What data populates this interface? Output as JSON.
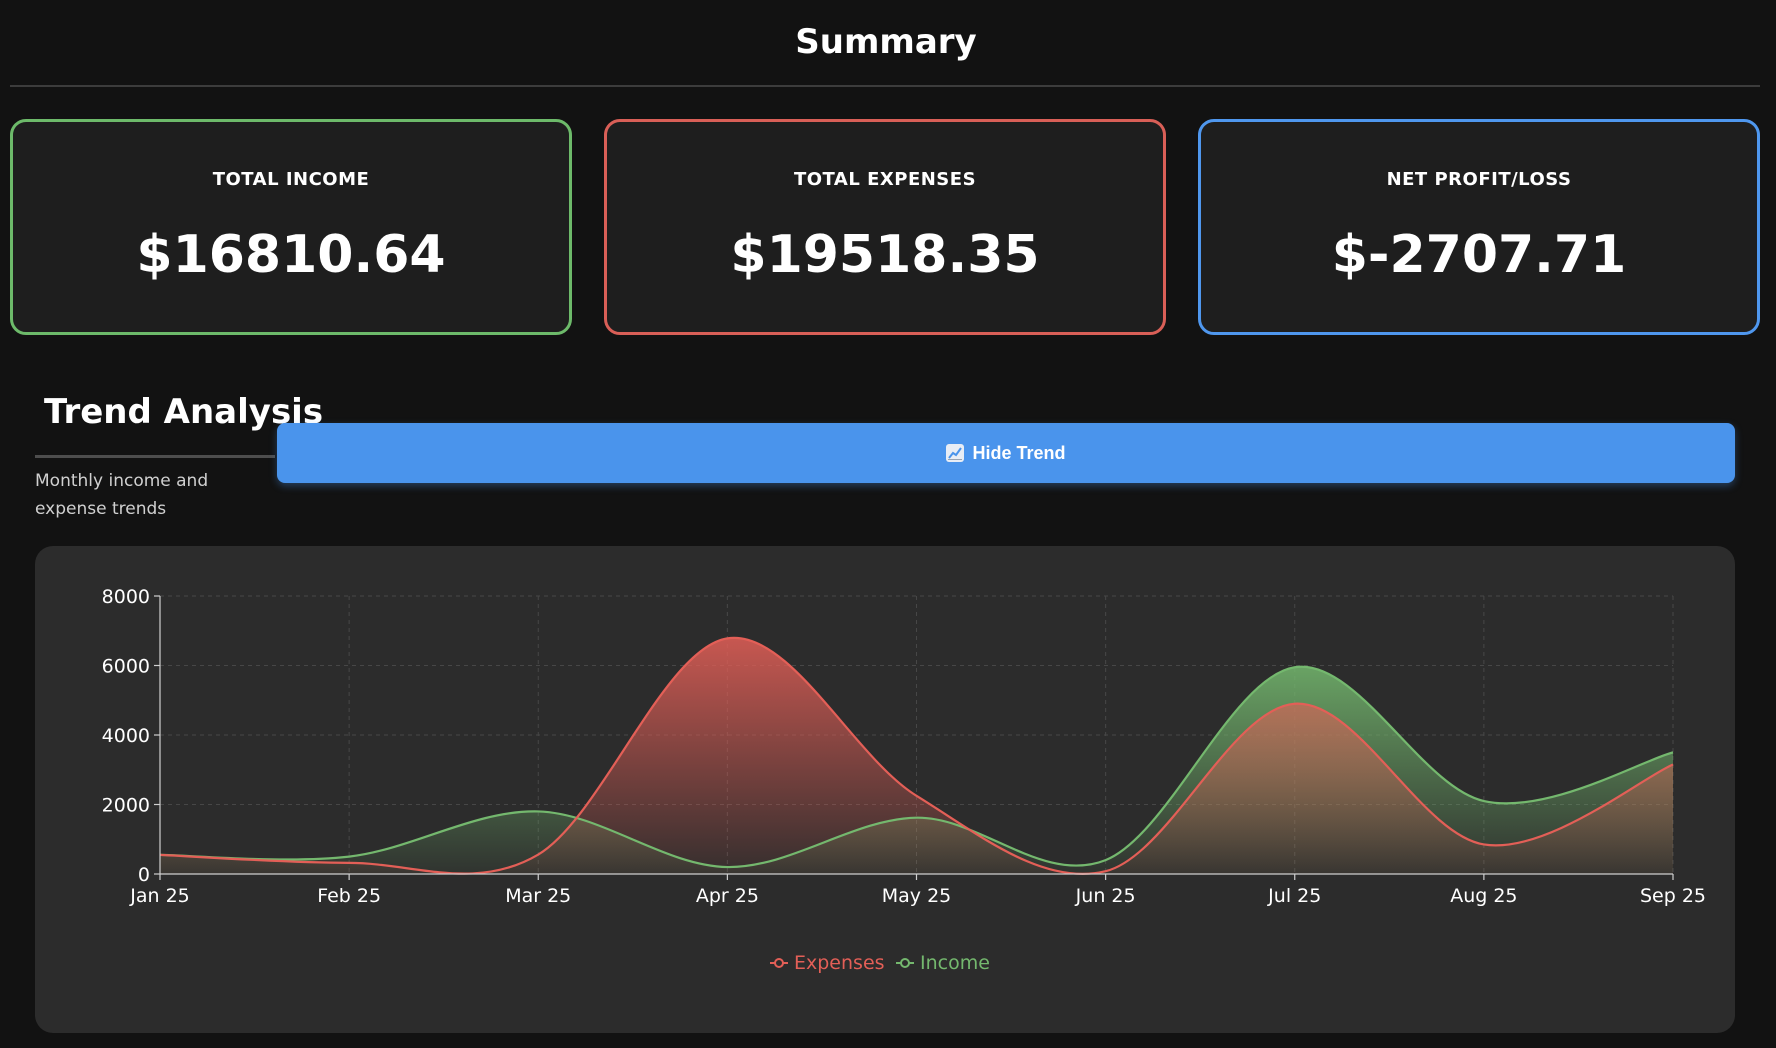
{
  "summary": {
    "title": "Summary",
    "cards": {
      "income": {
        "label": "TOTAL INCOME",
        "value": "$16810.64",
        "color": "#6dba6a"
      },
      "expenses": {
        "label": "TOTAL EXPENSES",
        "value": "$19518.35",
        "color": "#d95f57"
      },
      "net": {
        "label": "NET PROFIT/LOSS",
        "value": "$-2707.71",
        "color": "#4f97ee"
      }
    }
  },
  "trend": {
    "title": "Trend Analysis",
    "subtitle": "Monthly income and expense trends",
    "toggle_button": {
      "label": "Hide Trend",
      "icon": "chart-increasing-icon"
    }
  },
  "chart_data": {
    "type": "area",
    "x": [
      "Jan 25",
      "Feb 25",
      "Mar 25",
      "Apr 25",
      "May 25",
      "Jun 25",
      "Jul 25",
      "Aug 25",
      "Sep 25"
    ],
    "ylim": [
      0,
      8000
    ],
    "yticks": [
      0,
      2000,
      4000,
      6000,
      8000
    ],
    "grid": true,
    "legend_position": "bottom",
    "series": [
      {
        "name": "Expenses",
        "color": "#e35f57",
        "values": [
          550,
          320,
          560,
          6780,
          2250,
          80,
          4900,
          850,
          3150
        ]
      },
      {
        "name": "Income",
        "color": "#74b86e",
        "values": [
          550,
          500,
          1800,
          200,
          1620,
          400,
          5950,
          2100,
          3500
        ]
      }
    ]
  }
}
